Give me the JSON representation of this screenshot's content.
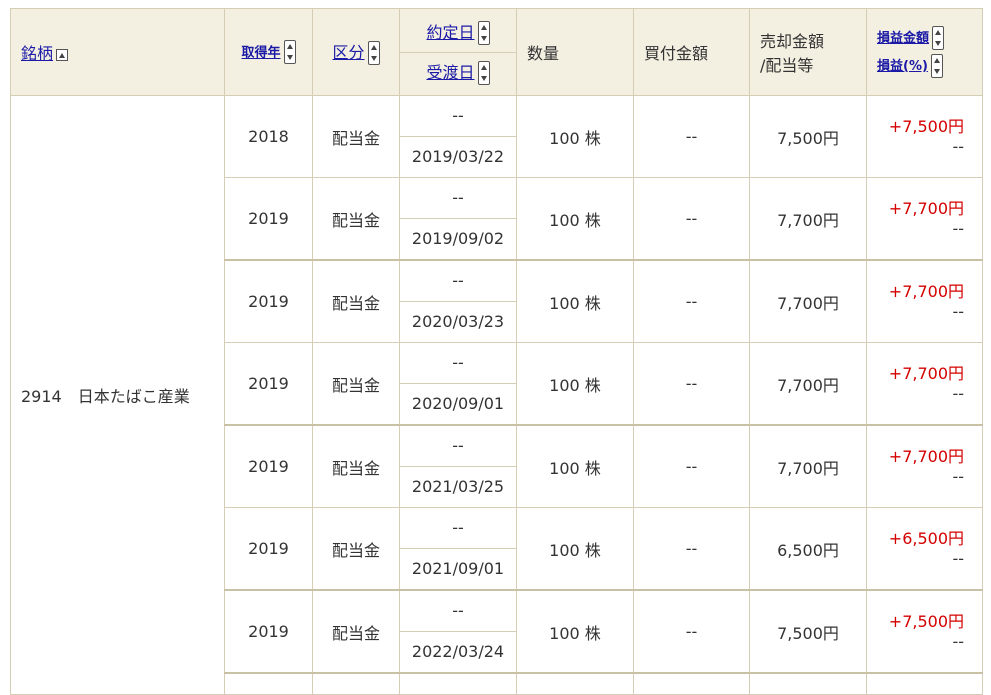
{
  "header": {
    "col_name": "銘柄",
    "col_year": "取得年",
    "col_kind": "区分",
    "col_contract_date": "約定日",
    "col_delivery_date": "受渡日",
    "col_qty": "数量",
    "col_buy": "買付金額",
    "col_sell_line1": "売却金額",
    "col_sell_line2": "/配当等",
    "col_pl_amount": "損益金額",
    "col_pl_pct": "損益(%)"
  },
  "security": {
    "code_name": "2914　日本たばこ産業"
  },
  "rows": [
    {
      "year": "2018",
      "kind": "配当金",
      "contract": "--",
      "delivery": "2019/03/22",
      "qty": "100 株",
      "buy": "--",
      "sell": "7,500円",
      "pl": "+7,500円",
      "pct": "--"
    },
    {
      "year": "2019",
      "kind": "配当金",
      "contract": "--",
      "delivery": "2019/09/02",
      "qty": "100 株",
      "buy": "--",
      "sell": "7,700円",
      "pl": "+7,700円",
      "pct": "--"
    },
    {
      "year": "2019",
      "kind": "配当金",
      "contract": "--",
      "delivery": "2020/03/23",
      "qty": "100 株",
      "buy": "--",
      "sell": "7,700円",
      "pl": "+7,700円",
      "pct": "--"
    },
    {
      "year": "2019",
      "kind": "配当金",
      "contract": "--",
      "delivery": "2020/09/01",
      "qty": "100 株",
      "buy": "--",
      "sell": "7,700円",
      "pl": "+7,700円",
      "pct": "--"
    },
    {
      "year": "2019",
      "kind": "配当金",
      "contract": "--",
      "delivery": "2021/03/25",
      "qty": "100 株",
      "buy": "--",
      "sell": "7,700円",
      "pl": "+7,700円",
      "pct": "--"
    },
    {
      "year": "2019",
      "kind": "配当金",
      "contract": "--",
      "delivery": "2021/09/01",
      "qty": "100 株",
      "buy": "--",
      "sell": "6,500円",
      "pl": "+6,500円",
      "pct": "--"
    },
    {
      "year": "2019",
      "kind": "配当金",
      "contract": "--",
      "delivery": "2022/03/24",
      "qty": "100 株",
      "buy": "--",
      "sell": "7,500円",
      "pl": "+7,500円",
      "pct": "--"
    }
  ],
  "colors": {
    "header_bg": "#f3efe1",
    "link": "#1a1aa6",
    "profit_positive": "#d40000",
    "border": "#d5ceb4"
  }
}
